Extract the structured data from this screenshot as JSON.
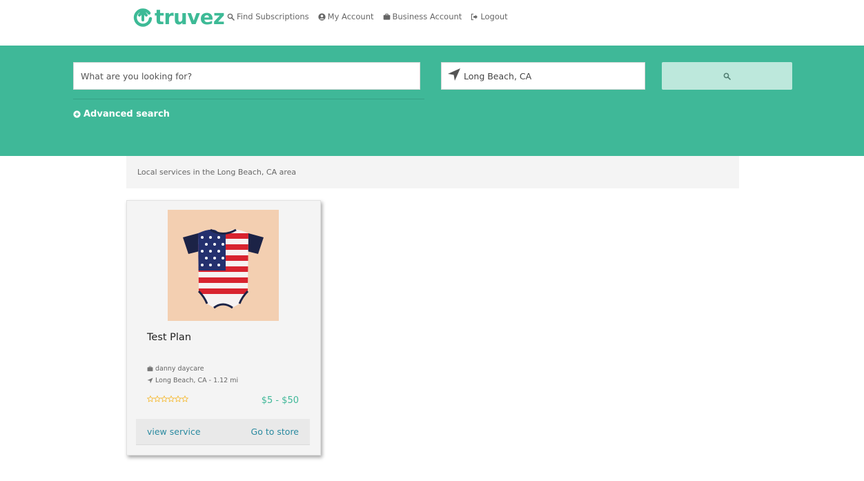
{
  "brand": {
    "name": "truvez",
    "color": "#3dba96"
  },
  "nav": [
    {
      "label": "Find Subscriptions",
      "icon": "search-icon"
    },
    {
      "label": "My Account",
      "icon": "user-circle-icon"
    },
    {
      "label": "Business Account",
      "icon": "briefcase-icon"
    },
    {
      "label": "Logout",
      "icon": "sign-out-icon"
    }
  ],
  "search": {
    "query_placeholder": "What are you looking for?",
    "location_value": "Long Beach, CA",
    "advanced_label": "Advanced search"
  },
  "results": {
    "heading": "Local services in the Long Beach, CA area"
  },
  "listing": {
    "title": "Test Plan",
    "business": "danny daycare",
    "location": "Long Beach, CA - 1.12 mi",
    "rating_stars_filled": 0,
    "rating_stars_total": 5,
    "price": "$5 - $50",
    "view_label": "view service",
    "store_label": "Go to store"
  },
  "colors": {
    "accent": "#3fb898",
    "link": "#2a8aa0",
    "star": "#f5b82e"
  }
}
